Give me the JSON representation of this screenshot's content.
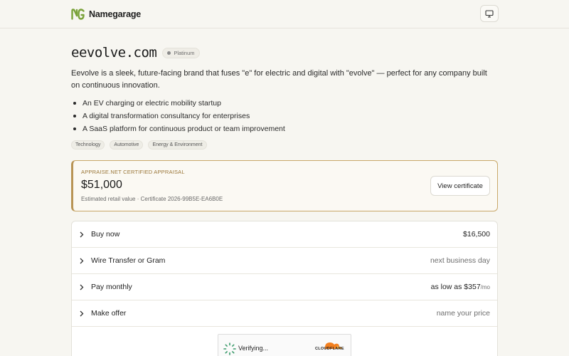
{
  "header": {
    "brand": "Namegarage",
    "logo_icon": "ng-logo-icon",
    "device_icon": "monitor-icon"
  },
  "domain": {
    "name": "eevolve.com",
    "tier": "Platinum",
    "description": "Eevolve is a sleek, future-facing brand that fuses \"e\" for electric and digital with \"evolve\" — perfect for any company built on continuous innovation.",
    "use_cases": [
      "An EV charging or electric mobility startup",
      "A digital transformation consultancy for enterprises",
      "A SaaS platform for continuous product or team improvement"
    ],
    "tags": [
      "Technology",
      "Automotive",
      "Energy & Environment"
    ]
  },
  "appraisal": {
    "label": "APPRAISE.NET CERTIFIED APPRAISAL",
    "value": "$51,000",
    "meta": "Estimated retail value · Certificate 2026-99B5E-EA6B0E",
    "button_label": "View certificate",
    "accent_color": "#b89455"
  },
  "purchase_options": [
    {
      "label": "Buy now",
      "value": "$16,500",
      "unit": ""
    },
    {
      "label": "Wire Transfer or Gram",
      "value": "next business day",
      "unit": ""
    },
    {
      "label": "Pay monthly",
      "value": "as low as $357",
      "unit": "/mo"
    },
    {
      "label": "Make offer",
      "value": "name your price",
      "unit": ""
    }
  ],
  "captcha": {
    "status": "Verifying...",
    "provider": "CLOUDFLARE"
  }
}
